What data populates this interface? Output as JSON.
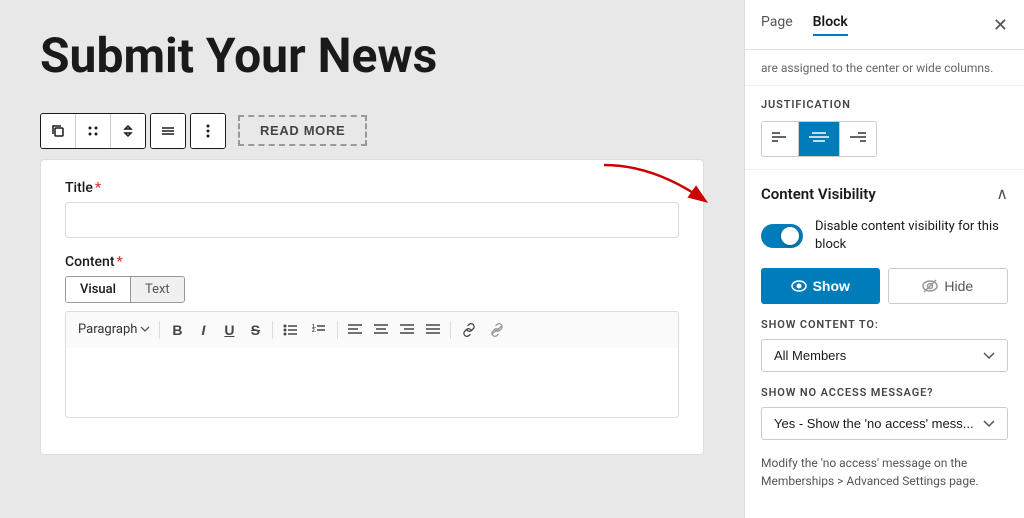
{
  "page": {
    "title": "Submit Your News"
  },
  "toolbar": {
    "read_more_label": "READ MORE"
  },
  "form": {
    "title_label": "Title",
    "content_label": "Content",
    "tab_visual": "Visual",
    "tab_text": "Text",
    "paragraph_label": "Paragraph"
  },
  "sidebar": {
    "tab_page": "Page",
    "tab_block": "Block",
    "scroll_hint": "are assigned to the center or wide columns.",
    "justification_label": "JUSTIFICATION",
    "content_visibility_title": "Content Visibility",
    "toggle_label": "Disable content visibility for this block",
    "show_button": "Show",
    "hide_button": "Hide",
    "show_content_to_label": "SHOW CONTENT TO:",
    "show_content_to_value": "All Members",
    "no_access_label": "SHOW NO ACCESS MESSAGE?",
    "no_access_value": "Yes - Show the 'no access' mess...",
    "no_access_hint": "Modify the 'no access' message on the Memberships > Advanced Settings page."
  }
}
